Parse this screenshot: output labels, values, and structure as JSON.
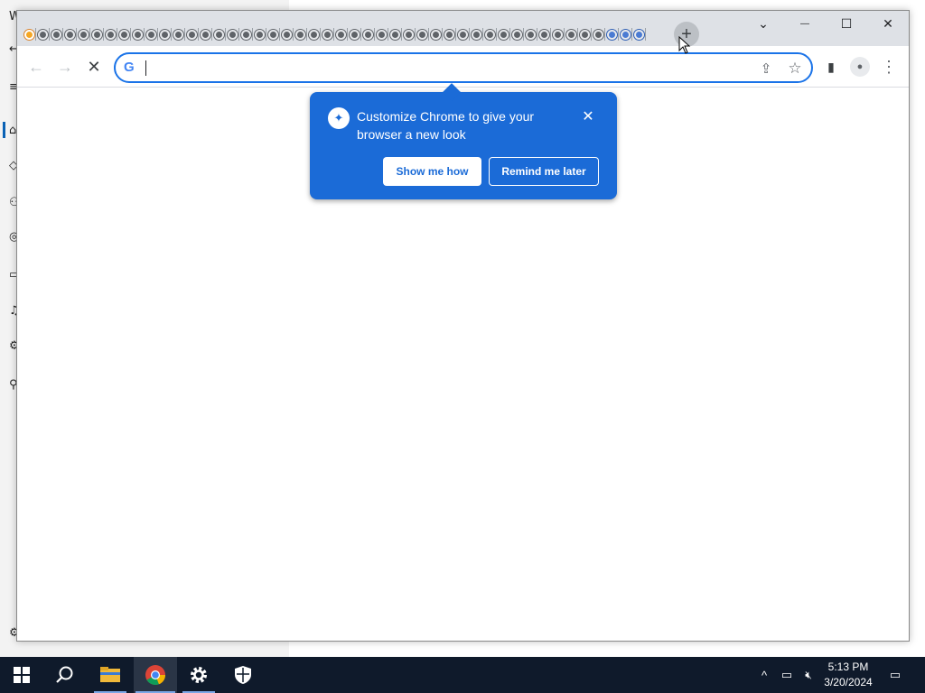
{
  "background_window": {
    "glyphs": [
      "W",
      "←",
      "≡",
      "⌂",
      "◇",
      "⚇",
      "◎",
      "▭",
      "♫",
      "⚙",
      "⚲",
      "⚙"
    ]
  },
  "browser": {
    "tab_count": 46,
    "new_tab_label": "+",
    "window_controls": {
      "tab_search": "⌄",
      "minimize": "—",
      "maximize": "☐",
      "close": "✕"
    },
    "omnibox": {
      "value": "",
      "placeholder": "",
      "search_engine_glyph": "G"
    }
  },
  "toolbar": {
    "back_icon": "←",
    "forward_icon": "→",
    "stop_icon": "✕",
    "share_icon": "⇪",
    "bookmark_icon": "☆",
    "side_panel_icon": "▮",
    "profile_icon": "●",
    "menu_icon": "⋮"
  },
  "promo": {
    "bulb_icon": "✦",
    "text": "Customize Chrome to give your browser a new look",
    "close_icon": "✕",
    "primary_button": "Show me how",
    "secondary_button": "Remind me later"
  },
  "taskbar": {
    "start_icon": "windows-logo",
    "items": [
      "search-icon",
      "file-explorer-icon",
      "chrome-icon",
      "settings-icon",
      "security-icon"
    ],
    "tray": {
      "chevron": "^",
      "network": "▭",
      "volume": "🔇︎"
    },
    "clock_time": "5:13 PM",
    "clock_date": "3/20/2024",
    "notification_icon": "▭"
  },
  "colors": {
    "accent": "#1a73e8",
    "promo_bg": "#1b6bd7",
    "titlebar_bg": "#dee1e6",
    "taskbar_bg": "#0f1a2b"
  }
}
